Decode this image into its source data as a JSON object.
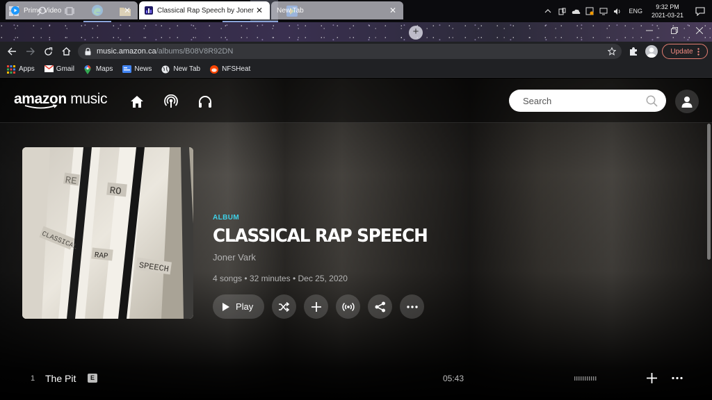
{
  "taskbar": {
    "icons": [
      "windows-start-icon",
      "search-icon",
      "task-view-icon",
      "edge-icon",
      "file-explorer-icon",
      "store-icon",
      "mail-icon",
      "settings-icon",
      "weather-icon",
      "chrome-icon",
      "play-store-icon"
    ],
    "language": "ENG",
    "time": "9:32 PM",
    "date": "2021-03-21"
  },
  "browser": {
    "tabs": [
      {
        "title": "Prime Video",
        "active": false
      },
      {
        "title": "Classical Rap Speech by Joner Va",
        "active": true
      },
      {
        "title": "New Tab",
        "active": false
      }
    ],
    "new_tab_symbol": "+",
    "url_host": "music.amazon.ca",
    "url_path": "/albums/B08V8R92DN",
    "update_label": "Update",
    "bookmarks": [
      "Apps",
      "Gmail",
      "Maps",
      "News",
      "New Tab",
      "NFSHeat"
    ]
  },
  "app": {
    "logo_word1": "amazon",
    "logo_word2": "music",
    "nav": [
      "home-icon",
      "podcast-icon",
      "headphones-icon"
    ],
    "search_placeholder": "Search"
  },
  "album": {
    "kind": "ALBUM",
    "title": "CLASSICAL RAP SPEECH",
    "artist": "Joner Vark",
    "songs": "4 songs",
    "duration": "32 minutes",
    "release_date": "Dec 25, 2020",
    "play_label": "Play",
    "art_words": [
      "CLASSICAL",
      "RAP",
      "SPEECH",
      "RE",
      "RO"
    ]
  },
  "tracks": [
    {
      "number": "1",
      "title": "The Pit",
      "explicit": "E",
      "duration": "05:43"
    }
  ],
  "colors": {
    "accent": "#3fd1e8",
    "update_red": "#f28b82"
  }
}
